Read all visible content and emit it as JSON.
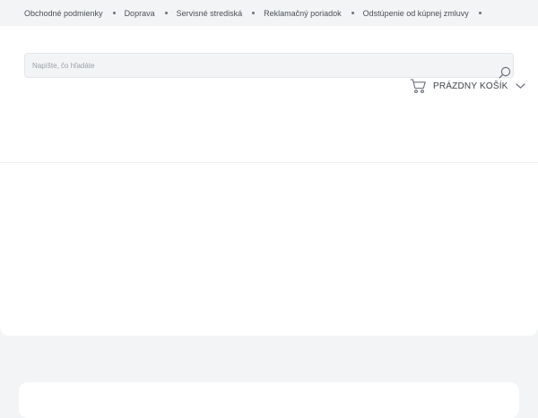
{
  "topnav": {
    "items": [
      {
        "label": "Obchodné podmienky"
      },
      {
        "label": "Doprava"
      },
      {
        "label": "Servisné strediská"
      },
      {
        "label": "Reklamačný poriadok"
      },
      {
        "label": "Odstúpenie od kúpnej zmluvy"
      }
    ]
  },
  "search": {
    "value": "",
    "placeholder": "Napíšte, čo hľadáte",
    "icon": "search-icon"
  },
  "cart": {
    "label": "PRÁZDNY KOŠÍK",
    "icon": "cart-icon",
    "toggle_icon": "chevron-down-icon"
  },
  "colors": {
    "page_bg": "#f3f4f6",
    "surface": "#ffffff",
    "text": "#4a4f57",
    "icon": "#6b7079"
  }
}
